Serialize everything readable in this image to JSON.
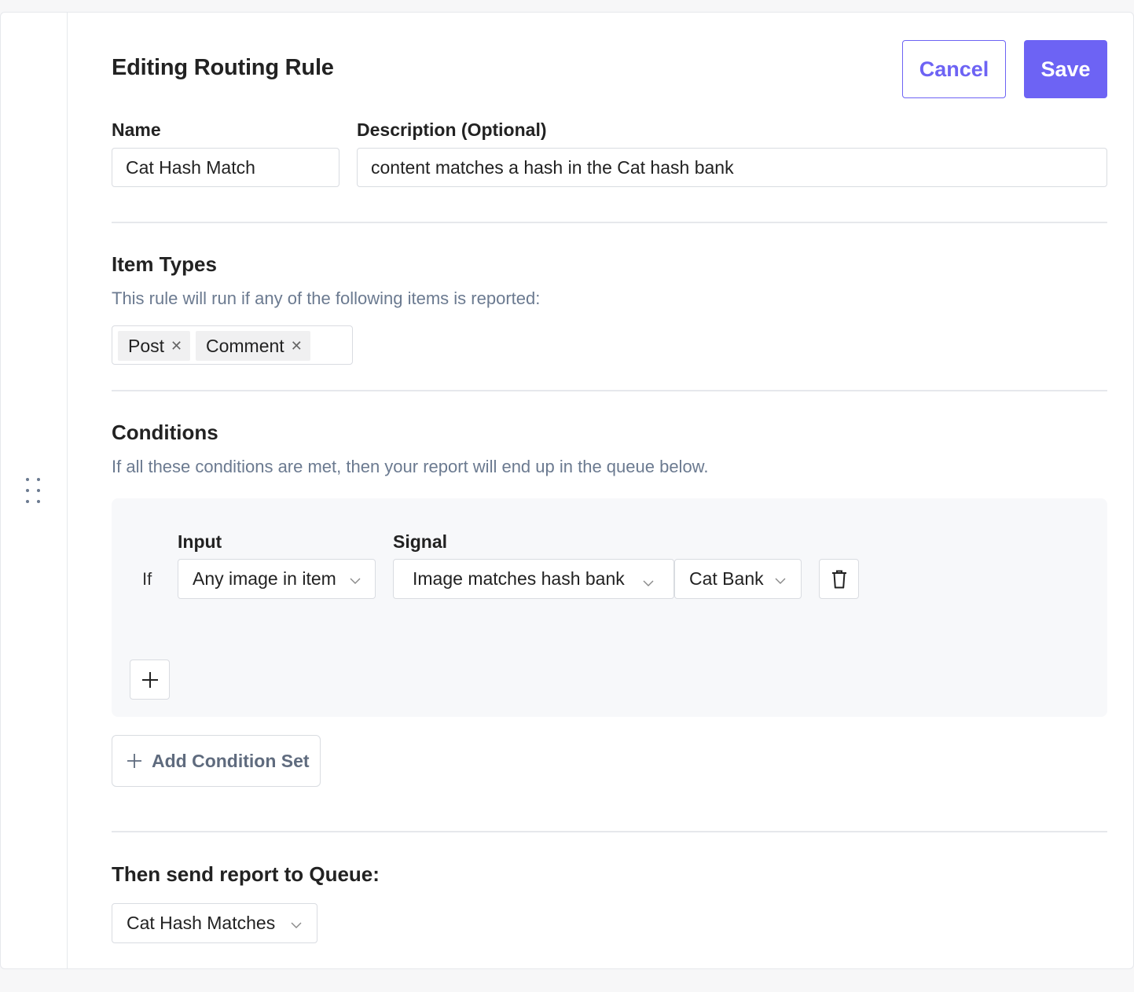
{
  "header": {
    "title": "Editing Routing Rule",
    "cancel_label": "Cancel",
    "save_label": "Save"
  },
  "name_field": {
    "label": "Name",
    "value": "Cat Hash Match"
  },
  "description_field": {
    "label": "Description (Optional)",
    "value": "content matches a hash in the Cat hash bank"
  },
  "item_types": {
    "title": "Item Types",
    "subtitle": "This rule will run if any of the following items is reported:",
    "tags": [
      {
        "label": "Post"
      },
      {
        "label": "Comment"
      }
    ]
  },
  "conditions": {
    "title": "Conditions",
    "subtitle": "If all these conditions are met, then your report will end up in the queue below.",
    "if_label": "If",
    "input_label": "Input",
    "signal_label": "Signal",
    "input_value": "Any image in item",
    "signal_value": "Image matches hash bank",
    "bank_value": "Cat Bank",
    "add_condition_set_label": "Add Condition Set"
  },
  "queue": {
    "title": "Then send report to Queue:",
    "value": "Cat Hash Matches"
  },
  "icons": {
    "drag": "drag-handle-icon",
    "delete": "trash-icon",
    "add": "plus-icon",
    "remove_tag": "close-icon",
    "dropdown": "chevron-down-icon"
  },
  "colors": {
    "accent": "#6d63f4",
    "muted_text": "#6b7a90",
    "panel_bg": "#f7f8fa"
  }
}
